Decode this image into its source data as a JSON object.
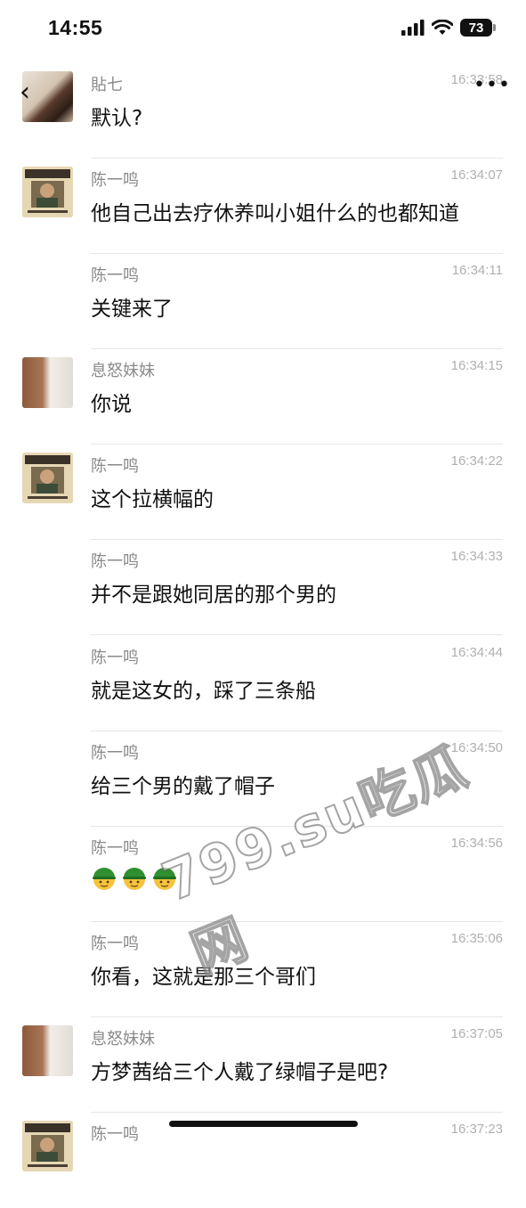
{
  "status_bar": {
    "time": "14:55",
    "battery": "73"
  },
  "messages": [
    {
      "name": "貼七",
      "time": "16:33:58",
      "text": "默认?",
      "avatar": "photo-avatar"
    },
    {
      "name": "陈一鸣",
      "time": "16:34:07",
      "text": "他自己出去疗休养叫小姐什么的也都知道",
      "avatar": "wanted-poster-avatar"
    },
    {
      "name": "陈一鸣",
      "time": "16:34:11",
      "text": "关键来了",
      "avatar": ""
    },
    {
      "name": "息怒妹妹",
      "time": "16:34:15",
      "text": "你说",
      "avatar": "girl-avatar"
    },
    {
      "name": "陈一鸣",
      "time": "16:34:22",
      "text": "这个拉横幅的",
      "avatar": "wanted-poster-avatar"
    },
    {
      "name": "陈一鸣",
      "time": "16:34:33",
      "text": "并不是跟她同居的那个男的",
      "avatar": ""
    },
    {
      "name": "陈一鸣",
      "time": "16:34:44",
      "text": "就是这女的，踩了三条船",
      "avatar": ""
    },
    {
      "name": "陈一鸣",
      "time": "16:34:50",
      "text": "给三个男的戴了帽子",
      "avatar": ""
    },
    {
      "name": "陈一鸣",
      "time": "16:34:56",
      "text": "",
      "avatar": "",
      "emojis": [
        "green-hat-emoji",
        "green-hat-emoji",
        "green-hat-emoji"
      ]
    },
    {
      "name": "陈一鸣",
      "time": "16:35:06",
      "text": "你看，这就是那三个哥们",
      "avatar": ""
    },
    {
      "name": "息怒妹妹",
      "time": "16:37:05",
      "text": "方梦茜给三个人戴了绿帽子是吧?",
      "avatar": "girl-avatar"
    },
    {
      "name": "陈一鸣",
      "time": "16:37:23",
      "text": "",
      "avatar": "wanted-poster-avatar"
    }
  ],
  "watermark": "799.su吃瓜网",
  "icons": {
    "back": "back-chevron-icon",
    "more": "more-dots-icon",
    "signal": "signal-icon",
    "wifi": "wifi-icon"
  }
}
